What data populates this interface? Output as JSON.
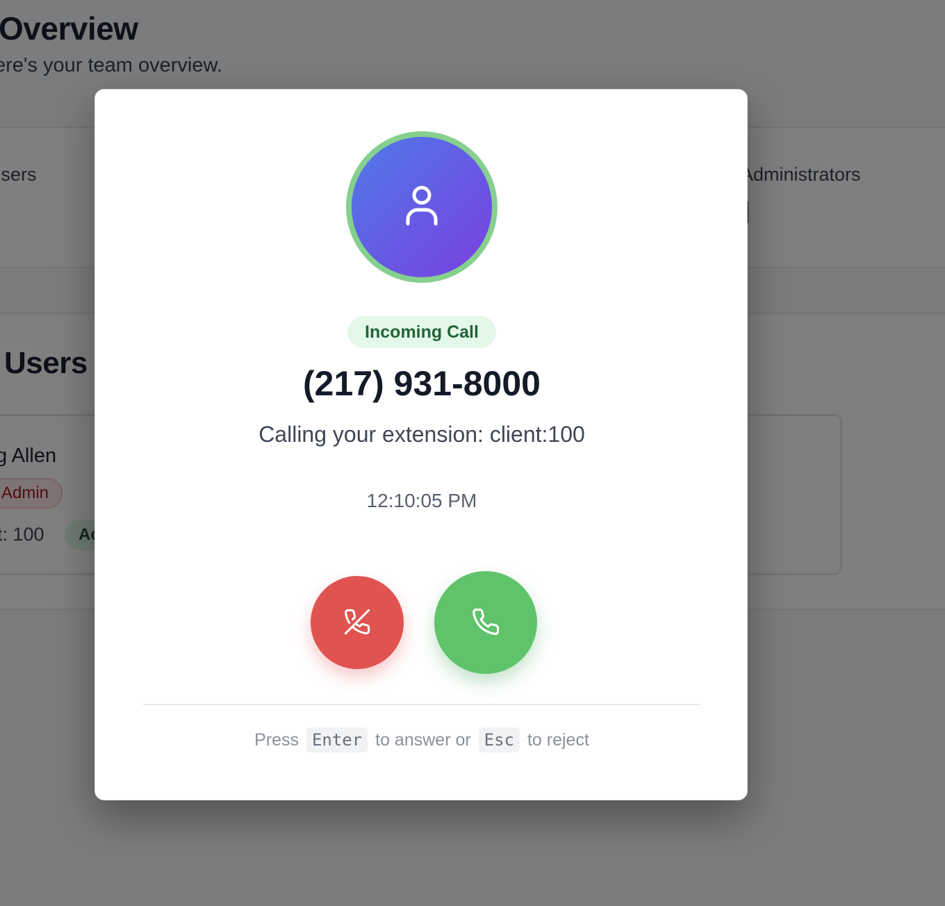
{
  "background": {
    "title": "Overview",
    "subtitle": "ere's your team overview.",
    "stats": {
      "left_label": "Jsers",
      "right_label": "Administrators",
      "right_value": "l"
    },
    "users_heading": "Users",
    "user_card": {
      "name": "g Allen",
      "role": "Admin",
      "extension": "t: 100",
      "status": "Ac"
    }
  },
  "call": {
    "badge": "Incoming Call",
    "phone_number": "(217) 931-8000",
    "extension_text": "Calling your extension: client:100",
    "time": "12:10:05 PM",
    "hint": {
      "press": "Press",
      "answer_key": "Enter",
      "middle": "to answer or",
      "reject_key": "Esc",
      "end": "to reject"
    }
  },
  "colors": {
    "avatar_gradient_start": "#4f7ae8",
    "avatar_gradient_end": "#7a3fe0",
    "ring": "#86d08f",
    "reject": "#e05350",
    "answer": "#5fc36b",
    "badge_bg": "#e4f8ea",
    "badge_text": "#226437"
  },
  "icons": {
    "avatar": "user-icon",
    "reject": "phone-off-icon",
    "answer": "phone-icon"
  }
}
